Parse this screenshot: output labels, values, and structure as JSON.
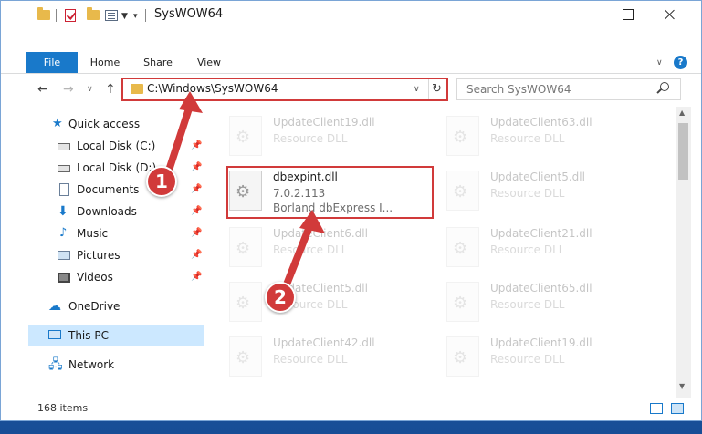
{
  "window": {
    "title": "SysWOW64"
  },
  "ribbon": {
    "tabs": [
      "File",
      "Home",
      "Share",
      "View"
    ],
    "help": "?"
  },
  "nav": {
    "address": "C:\\Windows\\SysWOW64",
    "search_placeholder": "Search SysWOW64"
  },
  "sidebar": {
    "items": [
      {
        "label": "Quick access",
        "icon": "star-icon",
        "pinned": false
      },
      {
        "label": "Local Disk (C:)",
        "icon": "disk-icon",
        "pinned": true
      },
      {
        "label": "Local Disk (D:)",
        "icon": "disk-icon",
        "pinned": true
      },
      {
        "label": "Documents",
        "icon": "documents-icon",
        "pinned": true
      },
      {
        "label": "Downloads",
        "icon": "download-icon",
        "pinned": true
      },
      {
        "label": "Music",
        "icon": "music-icon",
        "pinned": true
      },
      {
        "label": "Pictures",
        "icon": "pictures-icon",
        "pinned": true
      },
      {
        "label": "Videos",
        "icon": "videos-icon",
        "pinned": true
      },
      {
        "label": "OneDrive",
        "icon": "onedrive-icon",
        "pinned": false
      },
      {
        "label": "This PC",
        "icon": "pc-icon",
        "pinned": false,
        "selected": true
      },
      {
        "label": "Network",
        "icon": "network-icon",
        "pinned": false
      }
    ]
  },
  "files": {
    "left": [
      {
        "name": "UpdateClient19.dll",
        "line2": "Resource DLL",
        "line3": ""
      },
      {
        "name": "dbexpint.dll",
        "line2": "7.0.2.113",
        "line3": "Borland dbExpress I...",
        "highlighted": true
      },
      {
        "name": "UpdateClient6.dll",
        "line2": "Resource DLL",
        "line3": ""
      },
      {
        "name": "UpdateClient5.dll",
        "line2": "Resource DLL",
        "line3": ""
      },
      {
        "name": "UpdateClient42.dll",
        "line2": "Resource DLL",
        "line3": ""
      }
    ],
    "right": [
      {
        "name": "UpdateClient63.dll",
        "line2": "Resource DLL"
      },
      {
        "name": "UpdateClient5.dll",
        "line2": "Resource DLL"
      },
      {
        "name": "UpdateClient21.dll",
        "line2": "Resource DLL"
      },
      {
        "name": "UpdateClient65.dll",
        "line2": "Resource DLL"
      },
      {
        "name": "UpdateClient19.dll",
        "line2": "Resource DLL"
      }
    ]
  },
  "status": {
    "items_count": "168 items"
  },
  "callouts": {
    "one": "1",
    "two": "2"
  },
  "colors": {
    "accent": "#1979ca",
    "callout_red": "#d13a3a",
    "selected_bg": "#cce8ff"
  }
}
